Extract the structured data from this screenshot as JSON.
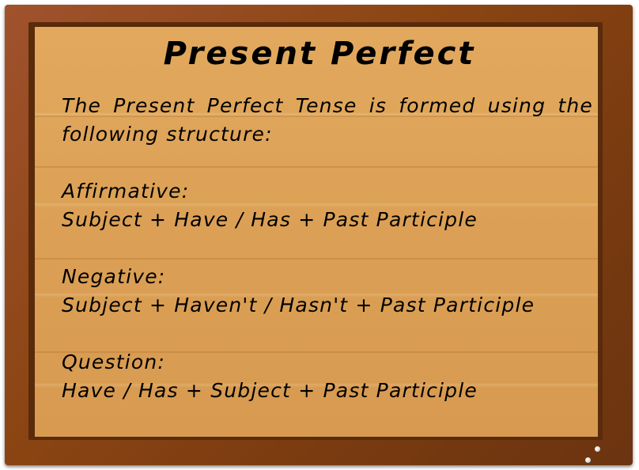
{
  "board": {
    "title": "Present Perfect",
    "intro": "The Present Perfect Tense is formed using the following structure:",
    "sections": [
      {
        "heading": "Affirmative:",
        "formula": "Subject + Have / Has + Past Participle"
      },
      {
        "heading": "Negative:",
        "formula": "Subject + Haven't / Hasn't + Past Participle"
      },
      {
        "heading": "Question:",
        "formula": "Have / Has + Subject + Past Participle"
      }
    ]
  },
  "colors": {
    "frame": "#8b4513",
    "board": "#dba055",
    "text": "#000000"
  },
  "icons": {
    "nails": "nail-icon"
  }
}
